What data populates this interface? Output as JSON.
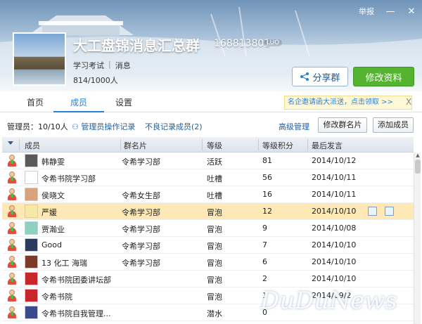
{
  "window": {
    "report_label": "举报",
    "min_label": "—",
    "close_label": "✕"
  },
  "group": {
    "name": "大工盘锦消息汇总群",
    "id": "168813801",
    "id_badge": "LUO",
    "tags": [
      "学习考试",
      "消息"
    ],
    "member_count": "814/1000人",
    "share_label": "分享群",
    "edit_label": "修改资料"
  },
  "tabs": [
    {
      "label": "首页",
      "active": false
    },
    {
      "label": "成员",
      "active": true
    },
    {
      "label": "设置",
      "active": false
    }
  ],
  "promo": {
    "text": "名企邀请函大派送，点击领取 >>",
    "close": "X"
  },
  "toolbar": {
    "admin_count": "管理员：10/10人",
    "admin_log": "管理员操作记录",
    "bad_records": "不良记录成员(2)",
    "advanced": "高级管理",
    "edit_card": "修改群名片",
    "add_member": "添加成员"
  },
  "table": {
    "headers": [
      "成员",
      "群名片",
      "等级",
      "等级积分",
      "最后发言"
    ],
    "rows": [
      {
        "name": "韩静雯",
        "card": "令希学习部",
        "level": "活跃",
        "points": "81",
        "last": "2014/10/12",
        "avatar": "#5a5a5a",
        "highlight": false
      },
      {
        "name": "令希书院学习部",
        "card": "",
        "level": "吐槽",
        "points": "56",
        "last": "2014/10/11",
        "avatar": "#ffffff",
        "highlight": false
      },
      {
        "name": "侯晓文",
        "card": "令希女生部",
        "level": "吐槽",
        "points": "16",
        "last": "2014/10/11",
        "avatar": "#d8a27c",
        "highlight": false
      },
      {
        "name": "严媛",
        "card": "令希学习部",
        "level": "冒泡",
        "points": "12",
        "last": "2014/10/10",
        "avatar": "#f6e9a8",
        "highlight": true
      },
      {
        "name": "贾瀚业",
        "card": "令希学习部",
        "level": "冒泡",
        "points": "9",
        "last": "2014/10/08",
        "avatar": "#8fd0c0",
        "highlight": false
      },
      {
        "name": "Good",
        "card": "令希学习部",
        "level": "冒泡",
        "points": "7",
        "last": "2014/10/10",
        "avatar": "#2c3a5e",
        "highlight": false
      },
      {
        "name": "13  化工  海瑞",
        "card": "令希学习部",
        "level": "冒泡",
        "points": "6",
        "last": "2014/10/10",
        "avatar": "#7b3a2a",
        "highlight": false
      },
      {
        "name": "令希书院团委讲坛部",
        "card": "",
        "level": "冒泡",
        "points": "2",
        "last": "2014/10/10",
        "avatar": "#c8262a",
        "highlight": false
      },
      {
        "name": "令希书院",
        "card": "",
        "level": "冒泡",
        "points": "1",
        "last": "2014/09/2",
        "avatar": "#c8262a",
        "highlight": false
      },
      {
        "name": "令希书院自我管理...",
        "card": "",
        "level": "潜水",
        "points": "0",
        "last": "",
        "avatar": "#3a4a8a",
        "highlight": false
      }
    ]
  },
  "watermark": "DuDuNews"
}
